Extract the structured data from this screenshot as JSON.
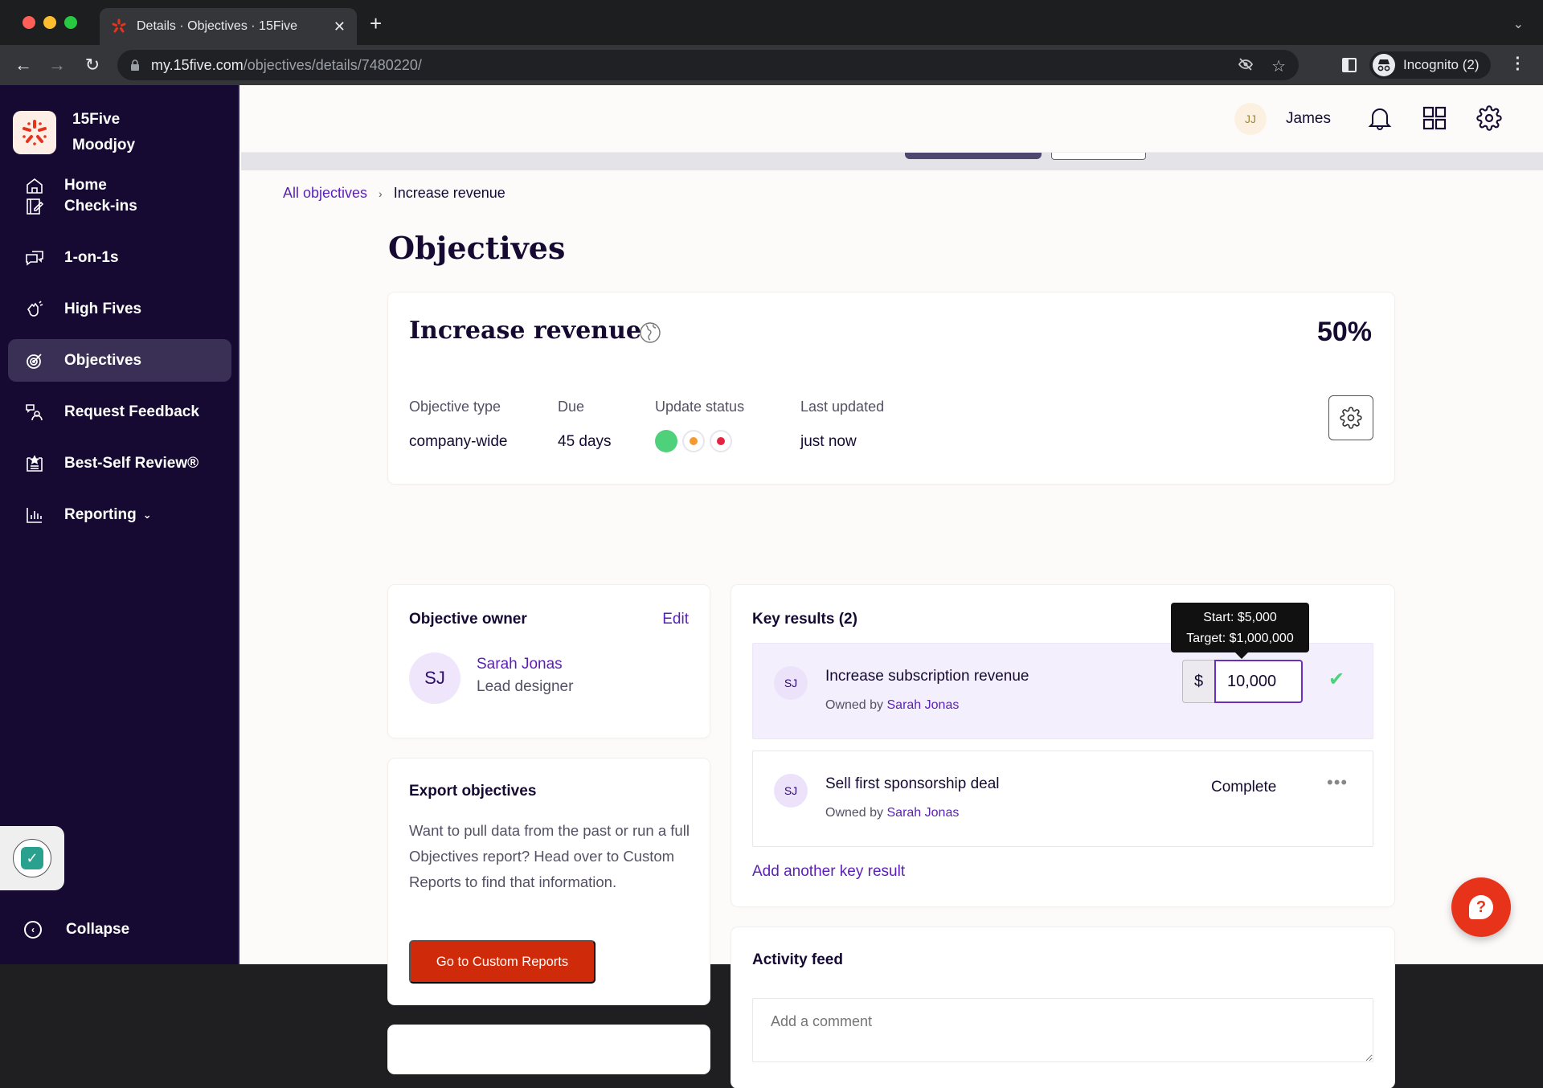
{
  "browser": {
    "tab_title": "Details · Objectives · 15Five",
    "url_host": "my.15five.com",
    "url_path": "/objectives/details/7480220/",
    "profile_label": "Incognito (2)"
  },
  "sidebar": {
    "org_line1": "15Five",
    "org_line2": "Moodjoy",
    "items": [
      {
        "label": "Home",
        "icon": "home-icon"
      },
      {
        "label": "Check-ins",
        "icon": "checkin-icon"
      },
      {
        "label": "1-on-1s",
        "icon": "chat-icon"
      },
      {
        "label": "High Fives",
        "icon": "high-five-icon"
      },
      {
        "label": "Objectives",
        "icon": "target-icon",
        "active": true
      },
      {
        "label": "Request Feedback",
        "icon": "feedback-icon"
      },
      {
        "label": "Best-Self Review®",
        "icon": "review-icon"
      },
      {
        "label": "Reporting",
        "icon": "chart-icon",
        "has_dropdown": true
      }
    ],
    "collapse_label": "Collapse"
  },
  "header": {
    "user_initials": "JJ",
    "user_name": "James"
  },
  "breadcrumb": {
    "parent": "All objectives",
    "current": "Increase revenue"
  },
  "page_title": "Objectives",
  "objective": {
    "title": "Increase revenue",
    "progress_percent": "50%",
    "meta": [
      {
        "label": "Objective type",
        "value": "company-wide"
      },
      {
        "label": "Due",
        "value": "45 days"
      },
      {
        "label": "Update status",
        "value": ""
      },
      {
        "label": "Last updated",
        "value": "just now"
      }
    ],
    "status_colors": {
      "green": "#4fd17c",
      "orange": "#f59a2f",
      "red": "#e3233f"
    }
  },
  "owner_card": {
    "heading": "Objective owner",
    "edit_label": "Edit",
    "initials": "SJ",
    "name": "Sarah Jonas",
    "role": "Lead designer"
  },
  "export_card": {
    "heading": "Export objectives",
    "description": "Want to pull data from the past or run a full Objectives report? Head over to Custom Reports to find that information.",
    "button_label": "Go to Custom Reports"
  },
  "key_results": {
    "heading": "Key results (2)",
    "items": [
      {
        "initials": "SJ",
        "title": "Increase subscription revenue",
        "owned_by_prefix": "Owned by",
        "owner": "Sarah Jonas",
        "currency_symbol": "$",
        "input_value": "10,000",
        "tooltip_start": "Start: $5,000",
        "tooltip_target": "Target: $1,000,000"
      },
      {
        "initials": "SJ",
        "title": "Sell first sponsorship deal",
        "owned_by_prefix": "Owned by",
        "owner": "Sarah Jonas",
        "status": "Complete",
        "more": "•••"
      }
    ],
    "add_label": "Add another key result"
  },
  "activity": {
    "heading": "Activity feed",
    "comment_placeholder": "Add a comment"
  },
  "colors": {
    "sidebar_bg": "#160a33",
    "accent_purple": "#5a1fb6",
    "brand_red": "#cf2a09"
  }
}
